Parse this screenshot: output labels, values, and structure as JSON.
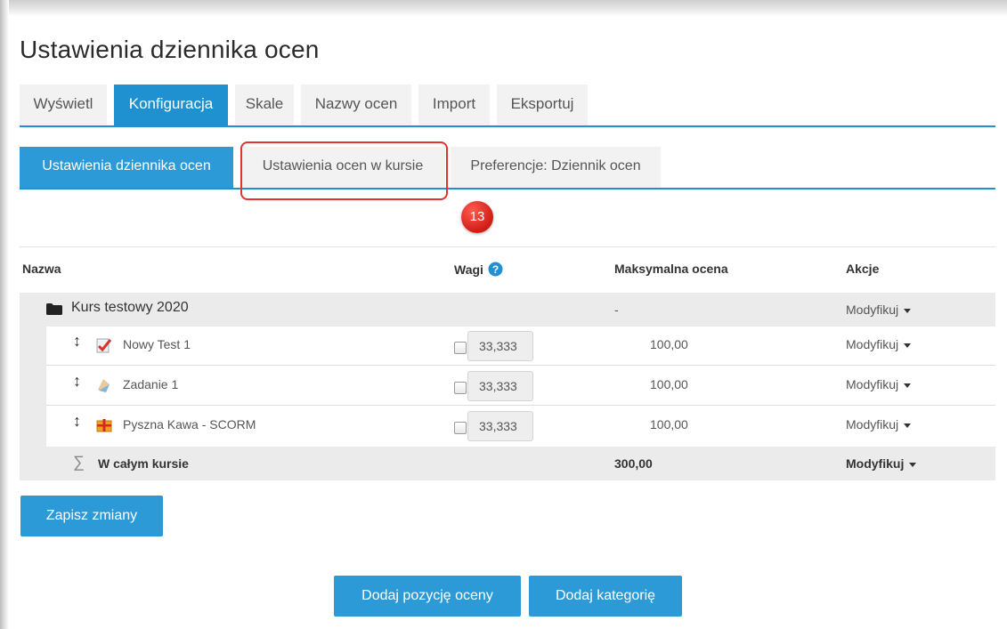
{
  "page_title": "Ustawienia dziennika ocen",
  "primary_tabs": [
    {
      "label": "Wyświetl"
    },
    {
      "label": "Konfiguracja"
    },
    {
      "label": "Skale"
    },
    {
      "label": "Nazwy ocen"
    },
    {
      "label": "Import"
    },
    {
      "label": "Eksportuj"
    }
  ],
  "secondary_tabs": [
    {
      "label": "Ustawienia dziennika ocen"
    },
    {
      "label": "Ustawienia ocen w kursie"
    },
    {
      "label": "Preferencje: Dziennik ocen"
    }
  ],
  "step_badge": "13",
  "table": {
    "headers": {
      "name": "Nazwa",
      "weights": "Wagi",
      "max": "Maksymalna ocena",
      "actions": "Akcje"
    },
    "category": {
      "name": "Kurs testowy 2020",
      "max": "-",
      "action": "Modyfikuj"
    },
    "items": [
      {
        "name": "Nowy Test 1",
        "icon": "quiz-icon",
        "weight": "33,333",
        "max": "100,00",
        "action": "Modyfikuj"
      },
      {
        "name": "Zadanie 1",
        "icon": "assignment-icon",
        "weight": "33,333",
        "max": "100,00",
        "action": "Modyfikuj"
      },
      {
        "name": "Pyszna Kawa - SCORM",
        "icon": "scorm-package-icon",
        "weight": "33,333",
        "max": "100,00",
        "action": "Modyfikuj"
      }
    ],
    "total": {
      "name": "W całym kursie",
      "max": "300,00",
      "action": "Modyfikuj"
    }
  },
  "buttons": {
    "save": "Zapisz zmiany",
    "add_item": "Dodaj pozycję oceny",
    "add_category": "Dodaj kategorię"
  },
  "colors": {
    "accent": "#1f90d0",
    "highlight": "#e23232"
  }
}
